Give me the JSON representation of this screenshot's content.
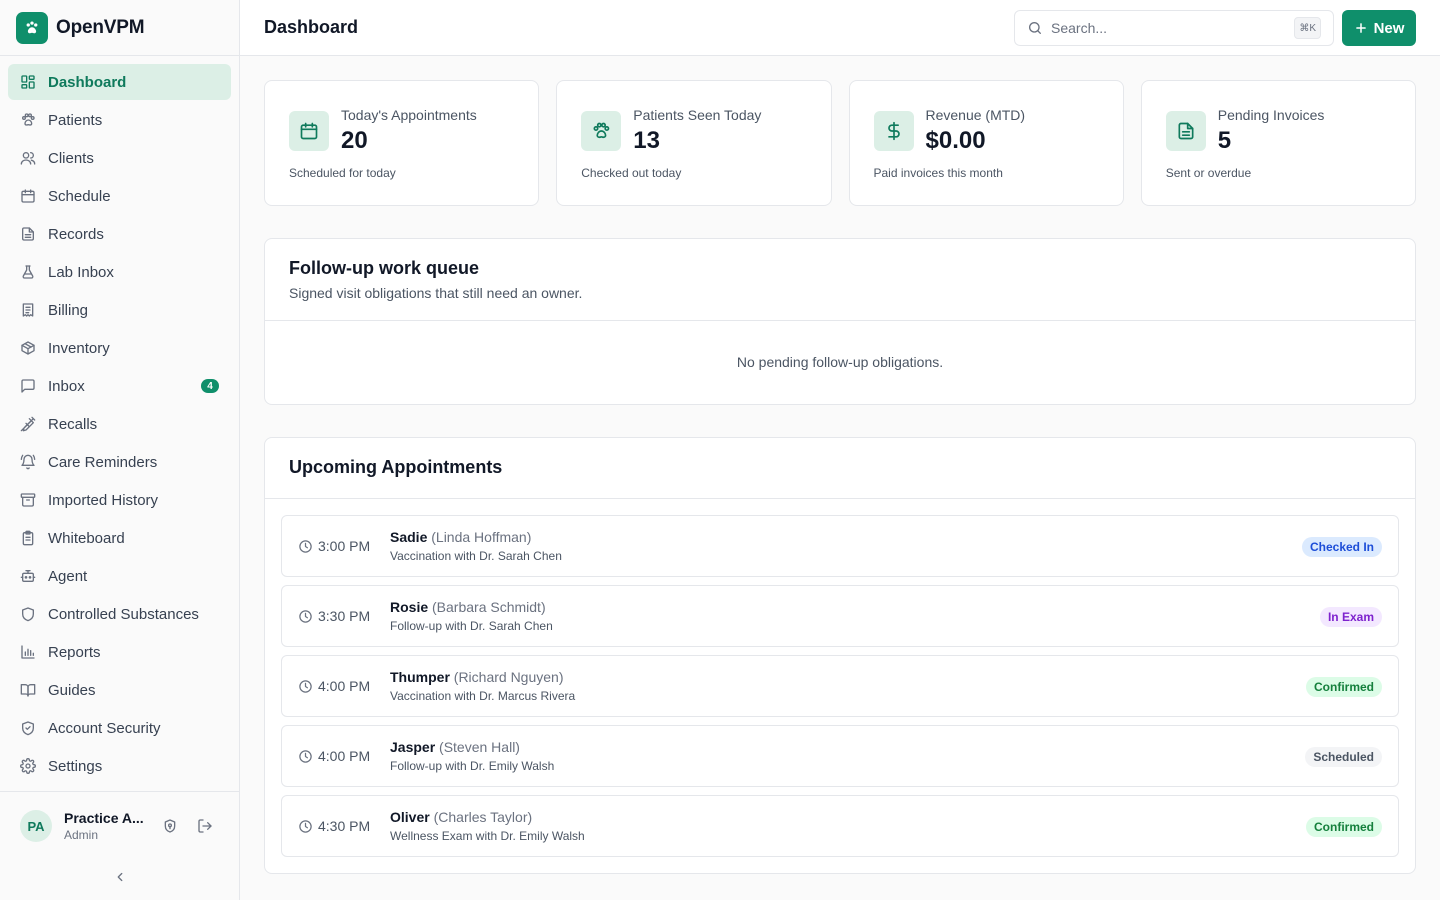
{
  "app": {
    "name": "OpenVPM",
    "logo_icon": "paw-icon"
  },
  "sidebar": {
    "items": [
      {
        "label": "Dashboard",
        "icon": "grid-icon",
        "active": true
      },
      {
        "label": "Patients",
        "icon": "paw-icon"
      },
      {
        "label": "Clients",
        "icon": "users-icon"
      },
      {
        "label": "Schedule",
        "icon": "calendar-icon"
      },
      {
        "label": "Records",
        "icon": "file-icon"
      },
      {
        "label": "Lab Inbox",
        "icon": "flask-icon"
      },
      {
        "label": "Billing",
        "icon": "receipt-icon"
      },
      {
        "label": "Inventory",
        "icon": "package-icon"
      },
      {
        "label": "Inbox",
        "icon": "message-icon",
        "badge": "4"
      },
      {
        "label": "Recalls",
        "icon": "syringe-icon"
      },
      {
        "label": "Care Reminders",
        "icon": "bell-icon"
      },
      {
        "label": "Imported History",
        "icon": "archive-icon"
      },
      {
        "label": "Whiteboard",
        "icon": "clipboard-icon"
      },
      {
        "label": "Agent",
        "icon": "bot-icon"
      },
      {
        "label": "Controlled Substances",
        "icon": "shield-icon"
      },
      {
        "label": "Reports",
        "icon": "bar-chart-icon"
      },
      {
        "label": "Guides",
        "icon": "book-icon"
      },
      {
        "label": "Account Security",
        "icon": "shield-check-icon"
      },
      {
        "label": "Settings",
        "icon": "gear-icon"
      }
    ],
    "user": {
      "initials": "PA",
      "name": "Practice A...",
      "role": "Admin"
    }
  },
  "header": {
    "title": "Dashboard",
    "search_placeholder": "Search...",
    "shortcut": "⌘K",
    "new_label": "New"
  },
  "stats": [
    {
      "label": "Today's Appointments",
      "value": "20",
      "sub": "Scheduled for today",
      "icon": "calendar-icon"
    },
    {
      "label": "Patients Seen Today",
      "value": "13",
      "sub": "Checked out today",
      "icon": "paw-icon"
    },
    {
      "label": "Revenue (MTD)",
      "value": "$0.00",
      "sub": "Paid invoices this month",
      "icon": "dollar-icon"
    },
    {
      "label": "Pending Invoices",
      "value": "5",
      "sub": "Sent or overdue",
      "icon": "file-icon"
    }
  ],
  "followup": {
    "title": "Follow-up work queue",
    "description": "Signed visit obligations that still need an owner.",
    "empty": "No pending follow-up obligations."
  },
  "appointments": {
    "title": "Upcoming Appointments",
    "items": [
      {
        "time": "3:00 PM",
        "patient": "Sadie",
        "client": "(Linda Hoffman)",
        "desc": "Vaccination with Dr. Sarah Chen",
        "status": "Checked In",
        "status_bg": "#dbeafe",
        "status_fg": "#1d4ed8"
      },
      {
        "time": "3:30 PM",
        "patient": "Rosie",
        "client": "(Barbara Schmidt)",
        "desc": "Follow-up with Dr. Sarah Chen",
        "status": "In Exam",
        "status_bg": "#f3e8ff",
        "status_fg": "#7e22ce"
      },
      {
        "time": "4:00 PM",
        "patient": "Thumper",
        "client": "(Richard Nguyen)",
        "desc": "Vaccination with Dr. Marcus Rivera",
        "status": "Confirmed",
        "status_bg": "#dcfce7",
        "status_fg": "#15803d"
      },
      {
        "time": "4:00 PM",
        "patient": "Jasper",
        "client": "(Steven Hall)",
        "desc": "Follow-up with Dr. Emily Walsh",
        "status": "Scheduled",
        "status_bg": "#f3f4f6",
        "status_fg": "#4b5563"
      },
      {
        "time": "4:30 PM",
        "patient": "Oliver",
        "client": "(Charles Taylor)",
        "desc": "Wellness Exam with Dr. Emily Walsh",
        "status": "Confirmed",
        "status_bg": "#dcfce7",
        "status_fg": "#15803d"
      }
    ]
  },
  "colors": {
    "accent": "#0f8f6b",
    "accent_soft": "#dcefe6"
  }
}
